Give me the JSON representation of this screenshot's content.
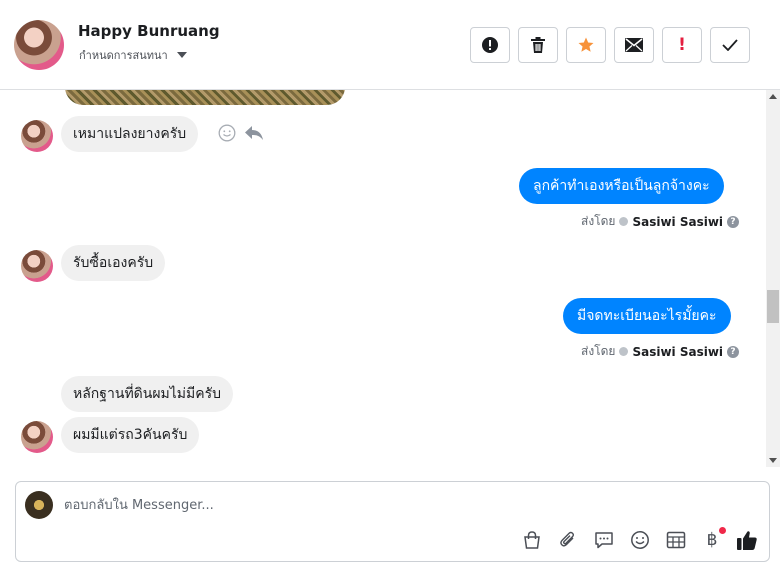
{
  "header": {
    "contact_name": "Happy Bunruang",
    "assign_label": "กำหนดการสนทนา"
  },
  "toolbar": {
    "spam_label": "!",
    "colors": {
      "star": "#f7923a",
      "flag": "#e41e3f"
    }
  },
  "messages": [
    {
      "direction": "in",
      "text": "เหมาแปลงยางครับ"
    },
    {
      "direction": "out",
      "text": "ลูกค้าทำเองหรือเป็นลูกจ้างคะ",
      "sent_by_label": "ส่งโดย",
      "sender": "Sasiwi Sasiwi"
    },
    {
      "direction": "in",
      "text": "รับซื้อเองครับ"
    },
    {
      "direction": "out",
      "text": "มีจดทะเบียนอะไรมั้ยคะ",
      "sent_by_label": "ส่งโดย",
      "sender": "Sasiwi Sasiwi"
    },
    {
      "direction": "in",
      "text": "หลักฐานที่ดินผมไม่มีครับ"
    },
    {
      "direction": "in",
      "text": "ผมมีแต่รถ3คันครับ"
    }
  ],
  "composer": {
    "placeholder": "ตอบกลับใน Messenger...",
    "baht_symbol": "฿"
  },
  "colors": {
    "outgoing_bubble": "#0084ff",
    "incoming_bubble": "#f0f0f0",
    "like": "#1c1e21"
  }
}
